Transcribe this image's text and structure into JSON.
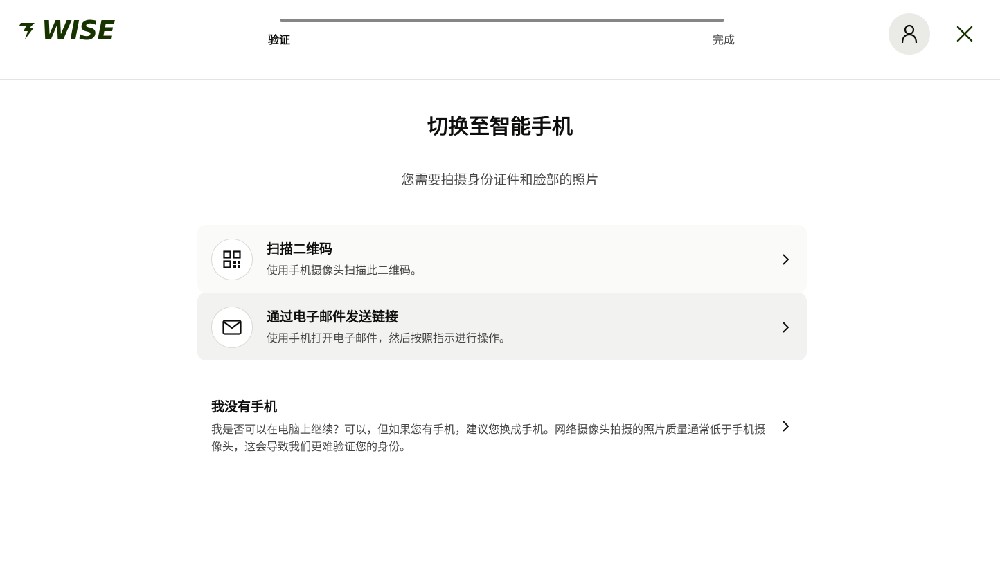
{
  "header": {
    "logo_text": "WISE",
    "steps": [
      {
        "label": "验证",
        "active": true
      },
      {
        "label": "完成",
        "active": false
      }
    ],
    "avatar_icon": "person-icon",
    "close_icon": "close-icon"
  },
  "main": {
    "title": "切换至智能手机",
    "subtitle": "您需要拍摄身份证件和脸部的照片",
    "options": [
      {
        "icon": "qr-code-icon",
        "title": "扫描二维码",
        "description": "使用手机摄像头扫描此二维码。"
      },
      {
        "icon": "envelope-icon",
        "title": "通过电子邮件发送链接",
        "description": "使用手机打开电子邮件，然后按照指示进行操作。"
      }
    ],
    "no_phone": {
      "title": "我没有手机",
      "description": "我是否可以在电脑上继续？可以，但如果您有手机，建议您换成手机。网络摄像头拍摄的照片质量通常低于手机摄像头，这会导致我们更难验证您的身份。"
    }
  },
  "colors": {
    "brand": "#163300",
    "text": "#0e0f0c",
    "muted": "#454745",
    "progress": "#868685"
  }
}
